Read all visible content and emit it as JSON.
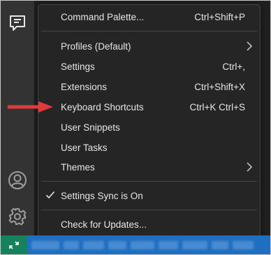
{
  "menu": {
    "items": [
      {
        "label": "Command Palette...",
        "shortcut": "Ctrl+Shift+P"
      },
      {
        "label": "Profiles (Default)",
        "shortcut": ""
      },
      {
        "label": "Settings",
        "shortcut": "Ctrl+,"
      },
      {
        "label": "Extensions",
        "shortcut": "Ctrl+Shift+X"
      },
      {
        "label": "Keyboard Shortcuts",
        "shortcut": "Ctrl+K Ctrl+S"
      },
      {
        "label": "User Snippets",
        "shortcut": ""
      },
      {
        "label": "User Tasks",
        "shortcut": ""
      },
      {
        "label": "Themes",
        "shortcut": ""
      },
      {
        "label": "Settings Sync is On",
        "shortcut": ""
      },
      {
        "label": "Check for Updates...",
        "shortcut": ""
      }
    ]
  },
  "icons": {
    "activity_top": "chat-feedback-icon",
    "accounts": "account-icon",
    "manage": "gear-icon",
    "remote": "remote-icon",
    "submenu": "chevron-right-icon",
    "checked": "check-icon",
    "annotation": "red-arrow-icon"
  },
  "colors": {
    "menu_bg": "#252526",
    "activity_bar": "#333333",
    "status_bar": "#1e6fc1",
    "remote": "#16825d",
    "annotation_arrow": "#e03a3a"
  }
}
